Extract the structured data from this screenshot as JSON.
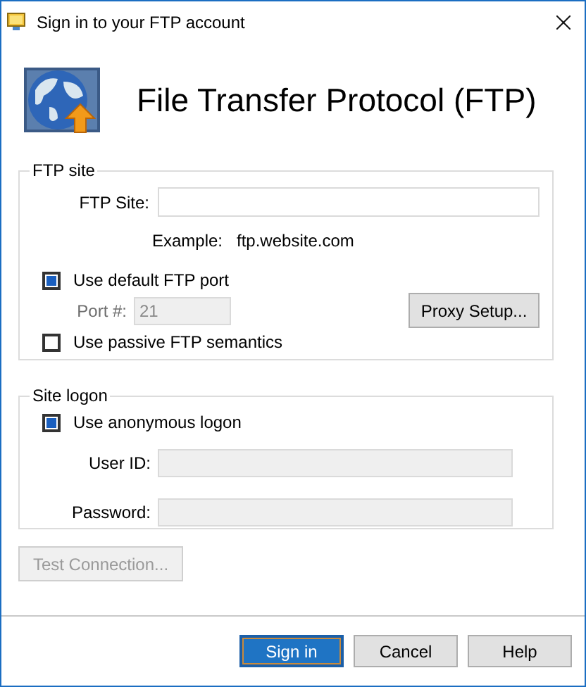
{
  "window": {
    "title": "Sign in to your FTP account"
  },
  "header": {
    "title": "File Transfer Protocol (FTP)"
  },
  "ftp_site": {
    "legend": "FTP site",
    "site_field": {
      "label": "FTP Site:",
      "disabled": false
    },
    "example_label": "Example:",
    "example_value": "ftp.website.com",
    "default_port": {
      "label": "Use default FTP port",
      "checked": true
    },
    "port_field": {
      "label": "Port #:",
      "value": "21",
      "disabled": true
    },
    "proxy_button": "Proxy Setup...",
    "passive": {
      "label": "Use passive FTP semantics",
      "checked": false
    }
  },
  "site_logon": {
    "legend": "Site logon",
    "anonymous": {
      "label": "Use anonymous logon",
      "checked": true
    },
    "fields": [
      {
        "label": "User ID:",
        "disabled": true
      },
      {
        "label": "Password:",
        "disabled": true
      }
    ]
  },
  "test_button": {
    "label": "Test Connection...",
    "disabled": true
  },
  "buttons": [
    {
      "label": "Sign in",
      "default": true
    },
    {
      "label": "Cancel",
      "default": false
    },
    {
      "label": "Help",
      "default": false
    }
  ]
}
